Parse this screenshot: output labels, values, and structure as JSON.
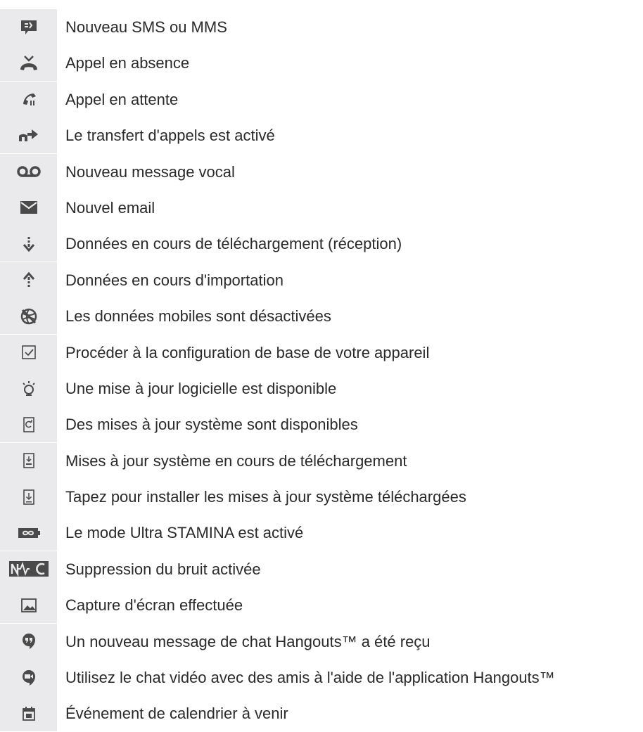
{
  "items": [
    {
      "icon": "sms-mms-icon",
      "label": "Nouveau SMS ou MMS"
    },
    {
      "icon": "missed-call-icon",
      "label": "Appel en absence"
    },
    {
      "icon": "call-on-hold-icon",
      "label": "Appel en attente"
    },
    {
      "icon": "call-forwarding-icon",
      "label": "Le transfert d'appels est activé"
    },
    {
      "icon": "voicemail-icon",
      "label": "Nouveau message vocal"
    },
    {
      "icon": "email-icon",
      "label": "Nouvel email"
    },
    {
      "icon": "download-icon",
      "label": "Données en cours de téléchargement (réception)"
    },
    {
      "icon": "upload-icon",
      "label": "Données en cours d'importation"
    },
    {
      "icon": "mobile-data-off-icon",
      "label": "Les données mobiles sont désactivées"
    },
    {
      "icon": "checkbox-setup-icon",
      "label": "Procéder à la configuration de base de votre appareil"
    },
    {
      "icon": "lightbulb-update-icon",
      "label": "Une mise à jour logicielle est disponible"
    },
    {
      "icon": "system-update-icon",
      "label": "Des mises à jour système sont disponibles"
    },
    {
      "icon": "system-update-downloading-icon",
      "label": "Mises à jour système en cours de téléchargement"
    },
    {
      "icon": "system-update-install-icon",
      "label": "Tapez pour installer les mises à jour système téléchargées"
    },
    {
      "icon": "ultra-stamina-icon",
      "label": "Le mode Ultra STAMINA est activé"
    },
    {
      "icon": "noise-cancel-icon",
      "label": "Suppression du bruit activée"
    },
    {
      "icon": "screenshot-icon",
      "label": "Capture d'écran effectuée"
    },
    {
      "icon": "hangouts-chat-icon",
      "label": "Un nouveau message de chat Hangouts™ a été reçu"
    },
    {
      "icon": "hangouts-video-icon",
      "label": "Utilisez le chat vidéo avec des amis à l'aide de l'application Hangouts™"
    },
    {
      "icon": "calendar-event-icon",
      "label": "Événement de calendrier à venir"
    }
  ],
  "colors": {
    "icon_bg": "#eaeaec",
    "icon_fg": "#4a4a4a",
    "text": "#2a2a2a"
  }
}
